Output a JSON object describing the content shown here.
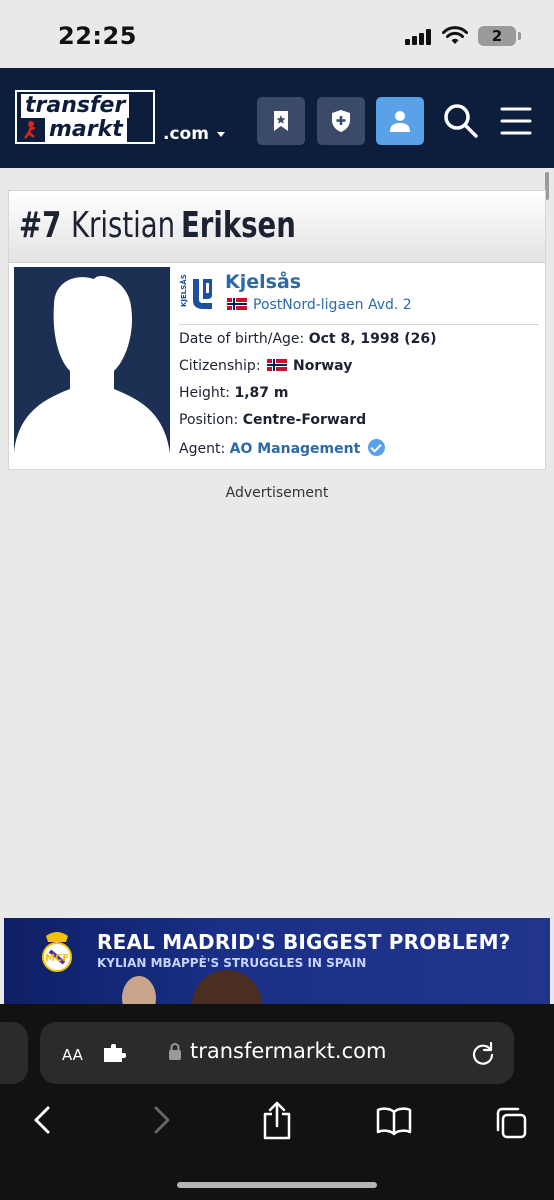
{
  "status_bar": {
    "time": "22:25",
    "battery": "2"
  },
  "header": {
    "logo_line1": "transfer",
    "logo_line2": "markt",
    "domain_suffix": ".com"
  },
  "player": {
    "number": "#7",
    "first_name": "Kristian",
    "last_name": "Eriksen",
    "club": "Kjelsås",
    "league": "PostNord-ligaen Avd. 2",
    "rows": {
      "dob_label": "Date of birth/Age:",
      "dob_value": "Oct 8, 1998 (26)",
      "citizenship_label": "Citizenship:",
      "citizenship_value": "Norway",
      "height_label": "Height:",
      "height_value": "1,87 m",
      "position_label": "Position:",
      "position_value": "Centre-Forward",
      "agent_label": "Agent:",
      "agent_value": "AO Management"
    }
  },
  "ad": {
    "label": "Advertisement"
  },
  "banner": {
    "headline": "REAL MADRID'S BIGGEST PROBLEM?",
    "subline": "KYLIAN MBAPPÈ'S STRUGGLES IN SPAIN"
  },
  "browser": {
    "text_size": "AA",
    "url": "transfermarkt.com"
  },
  "colors": {
    "header_bg": "#0d1e3c",
    "link": "#2b6aa6",
    "active_button": "#5aa1e8"
  }
}
